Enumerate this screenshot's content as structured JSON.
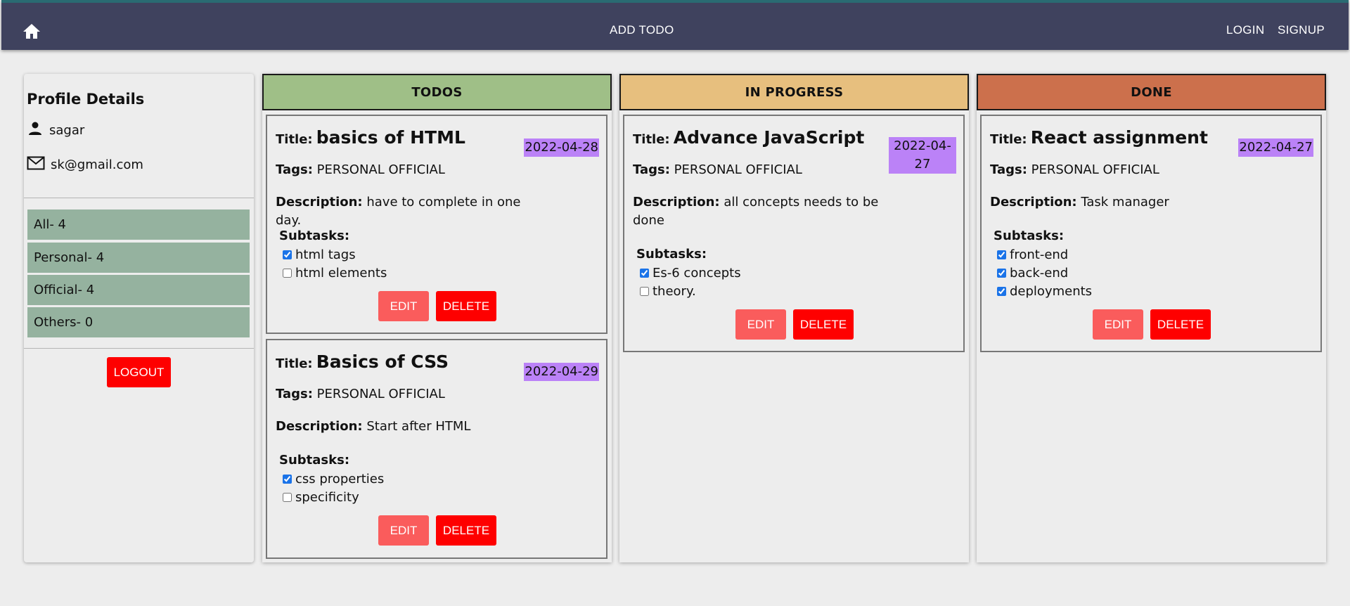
{
  "navbar": {
    "home_icon": "home-icon",
    "add_todo": "ADD TODO",
    "login": "LOGIN",
    "signup": "SIGNUP"
  },
  "profile": {
    "heading": "Profile Details",
    "username": "sagar",
    "email": "sk@gmail.com",
    "user_icon": "person-icon",
    "mail_icon": "mail-icon"
  },
  "filters": [
    {
      "label": "All- 4"
    },
    {
      "label": "Personal- 4"
    },
    {
      "label": "Official- 4"
    },
    {
      "label": "Others- 0"
    }
  ],
  "logout_label": "LOGOUT",
  "labels": {
    "title": "Title:",
    "tags": "Tags:",
    "description": "Description:",
    "subtasks": "Subtasks:",
    "edit": "EDIT",
    "delete": "DELETE"
  },
  "columns": [
    {
      "name": "TODOS",
      "color": "#9fbf87",
      "cards": [
        {
          "title": "basics of HTML",
          "date": "2022-04-28",
          "tags": "PERSONAL OFFICIAL",
          "description": "have to complete in one day.",
          "subtasks": [
            {
              "label": "html tags",
              "done": true
            },
            {
              "label": "html elements",
              "done": false
            }
          ]
        },
        {
          "title": "Basics of CSS",
          "date": "2022-04-29",
          "tags": "PERSONAL OFFICIAL",
          "description": "Start after HTML",
          "subtasks": [
            {
              "label": "css properties",
              "done": true
            },
            {
              "label": "specificity",
              "done": false
            }
          ]
        }
      ]
    },
    {
      "name": "IN PROGRESS",
      "color": "#e7bf7e",
      "cards": [
        {
          "title": "Advance JavaScript",
          "date": "2022-04-27",
          "tags": "PERSONAL OFFICIAL",
          "description": "all concepts needs to be done",
          "subtasks": [
            {
              "label": "Es-6 concepts",
              "done": true
            },
            {
              "label": "theory.",
              "done": false
            }
          ]
        }
      ]
    },
    {
      "name": "DONE",
      "color": "#cc704c",
      "cards": [
        {
          "title": "React assignment",
          "date": "2022-04-27",
          "tags": "PERSONAL OFFICIAL",
          "description": "Task manager",
          "subtasks": [
            {
              "label": "front-end",
              "done": true
            },
            {
              "label": "back-end",
              "done": true
            },
            {
              "label": "deployments",
              "done": true
            }
          ]
        }
      ]
    }
  ]
}
